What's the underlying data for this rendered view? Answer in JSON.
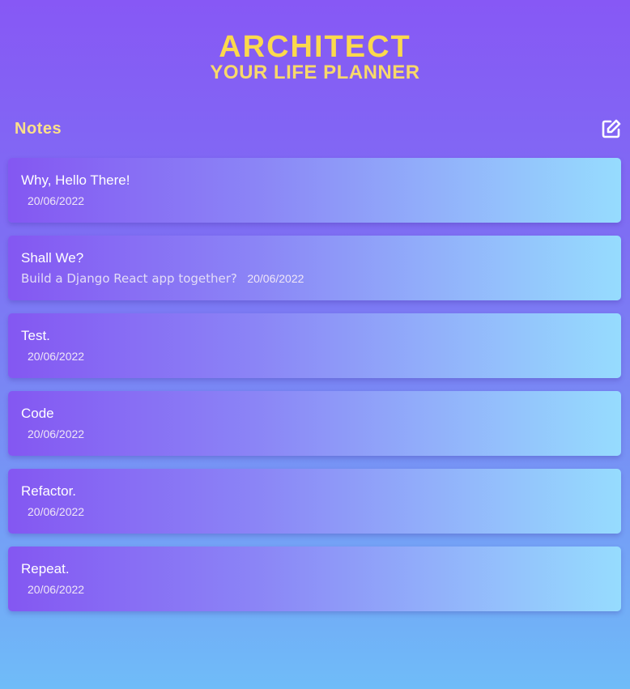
{
  "header": {
    "title": "ARCHITECT",
    "subtitle": "YOUR LIFE PLANNER"
  },
  "notes_section": {
    "heading": "Notes",
    "add_icon": "edit-square-icon"
  },
  "notes": [
    {
      "title": "Why, Hello There!",
      "preview": "",
      "date": "20/06/2022"
    },
    {
      "title": "Shall We?",
      "preview": "Build a Django React app together?",
      "date": "20/06/2022"
    },
    {
      "title": "Test.",
      "preview": "",
      "date": "20/06/2022"
    },
    {
      "title": "Code",
      "preview": "",
      "date": "20/06/2022"
    },
    {
      "title": "Refactor.",
      "preview": "",
      "date": "20/06/2022"
    },
    {
      "title": "Repeat.",
      "preview": "",
      "date": "20/06/2022"
    }
  ],
  "colors": {
    "title_yellow": "#fbd94d",
    "card_gradient_start": "#8457f2",
    "card_gradient_end": "#96dcfe"
  }
}
